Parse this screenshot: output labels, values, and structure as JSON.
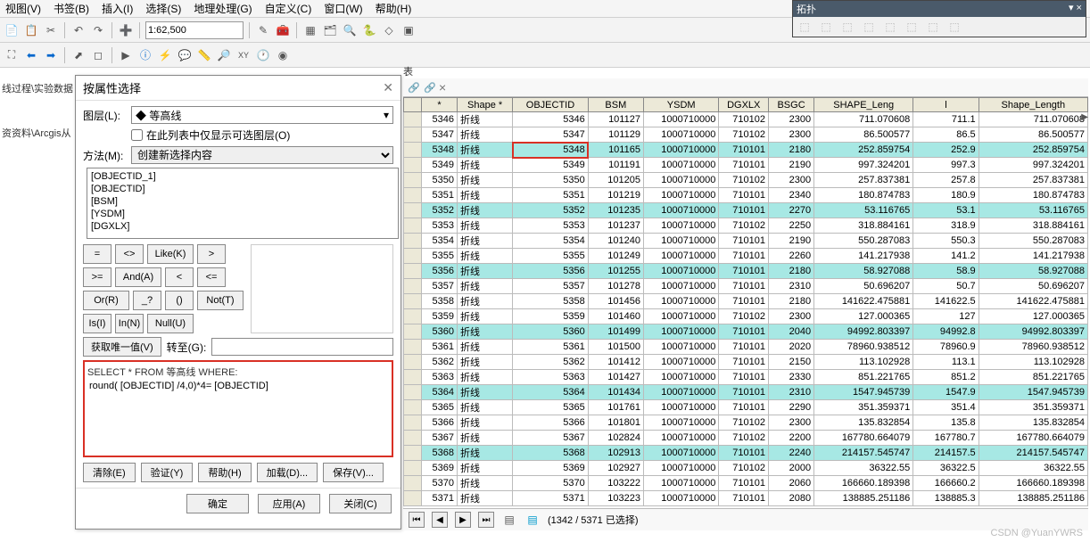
{
  "menu": [
    "视图(V)",
    "书签(B)",
    "插入(I)",
    "选择(S)",
    "地理处理(G)",
    "自定义(C)",
    "窗口(W)",
    "帮助(H)"
  ],
  "scale": "1:62,500",
  "topology": {
    "title": "拓扑",
    "close": "▾ ×"
  },
  "tree": {
    "l1": "线过程\\实验数据",
    "l2": "资资料\\Arcgis从"
  },
  "dialog": {
    "title": "按属性选择",
    "layer_label": "图层(L):",
    "layer_value": "◆ 等高线",
    "only_show": "在此列表中仅显示可选图层(O)",
    "method_label": "方法(M):",
    "method_value": "创建新选择内容",
    "fields": [
      "[OBJECTID_1]",
      "[OBJECTID]",
      "[BSM]",
      "[YSDM]",
      "[DGXLX]"
    ],
    "ops": {
      "eq": "=",
      "ne": "<>",
      "like": "Like(K)",
      "gt": ">",
      "ge": ">=",
      "and": "And(A)",
      "lt": "<",
      "le": "<=",
      "or": "Or(R)",
      "pct": "_?",
      "paren": "()",
      "not": "Not(T)",
      "is": "Is(I)",
      "in": "In(N)",
      "null": "Null(U)"
    },
    "uv": "获取唯一值(V)",
    "goto": "转至(G):",
    "sql_label": "SELECT * FROM 等高线 WHERE:",
    "sql_value": "round( [OBJECTID] /4,0)*4= [OBJECTID]",
    "btns": {
      "clear": "清除(E)",
      "verify": "验证(Y)",
      "help": "帮助(H)",
      "load": "加载(D)...",
      "save": "保存(V)..."
    },
    "footer": {
      "ok": "确定",
      "apply": "应用(A)",
      "close": "关闭(C)"
    }
  },
  "table": {
    "headers": [
      "*",
      "Shape *",
      "OBJECTID",
      "BSM",
      "YSDM",
      "DGXLX",
      "BSGC",
      "SHAPE_Leng",
      "l",
      "Shape_Length"
    ],
    "footer_text": "(1342 / 5371 已选择)",
    "shape_word": "折线",
    "rows": [
      {
        "fid": 5346,
        "oid": 5346,
        "bsm": 101127,
        "ysdm": "1000710000",
        "dgxlx": 710102,
        "bsgc": 2300,
        "len": "711.070608",
        "l": "711.1",
        "slen": "711.070608",
        "sel": false
      },
      {
        "fid": 5347,
        "oid": 5347,
        "bsm": 101129,
        "ysdm": "1000710000",
        "dgxlx": 710102,
        "bsgc": 2300,
        "len": "86.500577",
        "l": "86.5",
        "slen": "86.500577",
        "sel": false
      },
      {
        "fid": 5348,
        "oid": 5348,
        "bsm": 101165,
        "ysdm": "1000710000",
        "dgxlx": 710101,
        "bsgc": 2180,
        "len": "252.859754",
        "l": "252.9",
        "slen": "252.859754",
        "sel": true,
        "hl": true
      },
      {
        "fid": 5349,
        "oid": 5349,
        "bsm": 101191,
        "ysdm": "1000710000",
        "dgxlx": 710101,
        "bsgc": 2190,
        "len": "997.324201",
        "l": "997.3",
        "slen": "997.324201",
        "sel": false
      },
      {
        "fid": 5350,
        "oid": 5350,
        "bsm": 101205,
        "ysdm": "1000710000",
        "dgxlx": 710102,
        "bsgc": 2300,
        "len": "257.837381",
        "l": "257.8",
        "slen": "257.837381",
        "sel": false
      },
      {
        "fid": 5351,
        "oid": 5351,
        "bsm": 101219,
        "ysdm": "1000710000",
        "dgxlx": 710101,
        "bsgc": 2340,
        "len": "180.874783",
        "l": "180.9",
        "slen": "180.874783",
        "sel": false
      },
      {
        "fid": 5352,
        "oid": 5352,
        "bsm": 101235,
        "ysdm": "1000710000",
        "dgxlx": 710101,
        "bsgc": 2270,
        "len": "53.116765",
        "l": "53.1",
        "slen": "53.116765",
        "sel": true
      },
      {
        "fid": 5353,
        "oid": 5353,
        "bsm": 101237,
        "ysdm": "1000710000",
        "dgxlx": 710102,
        "bsgc": 2250,
        "len": "318.884161",
        "l": "318.9",
        "slen": "318.884161",
        "sel": false
      },
      {
        "fid": 5354,
        "oid": 5354,
        "bsm": 101240,
        "ysdm": "1000710000",
        "dgxlx": 710101,
        "bsgc": 2190,
        "len": "550.287083",
        "l": "550.3",
        "slen": "550.287083",
        "sel": false
      },
      {
        "fid": 5355,
        "oid": 5355,
        "bsm": 101249,
        "ysdm": "1000710000",
        "dgxlx": 710101,
        "bsgc": 2260,
        "len": "141.217938",
        "l": "141.2",
        "slen": "141.217938",
        "sel": false
      },
      {
        "fid": 5356,
        "oid": 5356,
        "bsm": 101255,
        "ysdm": "1000710000",
        "dgxlx": 710101,
        "bsgc": 2180,
        "len": "58.927088",
        "l": "58.9",
        "slen": "58.927088",
        "sel": true
      },
      {
        "fid": 5357,
        "oid": 5357,
        "bsm": 101278,
        "ysdm": "1000710000",
        "dgxlx": 710101,
        "bsgc": 2310,
        "len": "50.696207",
        "l": "50.7",
        "slen": "50.696207",
        "sel": false
      },
      {
        "fid": 5358,
        "oid": 5358,
        "bsm": 101456,
        "ysdm": "1000710000",
        "dgxlx": 710101,
        "bsgc": 2180,
        "len": "141622.475881",
        "l": "141622.5",
        "slen": "141622.475881",
        "sel": false
      },
      {
        "fid": 5359,
        "oid": 5359,
        "bsm": 101460,
        "ysdm": "1000710000",
        "dgxlx": 710102,
        "bsgc": 2300,
        "len": "127.000365",
        "l": "127",
        "slen": "127.000365",
        "sel": false
      },
      {
        "fid": 5360,
        "oid": 5360,
        "bsm": 101499,
        "ysdm": "1000710000",
        "dgxlx": 710101,
        "bsgc": 2040,
        "len": "94992.803397",
        "l": "94992.8",
        "slen": "94992.803397",
        "sel": true
      },
      {
        "fid": 5361,
        "oid": 5361,
        "bsm": 101500,
        "ysdm": "1000710000",
        "dgxlx": 710101,
        "bsgc": 2020,
        "len": "78960.938512",
        "l": "78960.9",
        "slen": "78960.938512",
        "sel": false
      },
      {
        "fid": 5362,
        "oid": 5362,
        "bsm": 101412,
        "ysdm": "1000710000",
        "dgxlx": 710101,
        "bsgc": 2150,
        "len": "113.102928",
        "l": "113.1",
        "slen": "113.102928",
        "sel": false
      },
      {
        "fid": 5363,
        "oid": 5363,
        "bsm": 101427,
        "ysdm": "1000710000",
        "dgxlx": 710101,
        "bsgc": 2330,
        "len": "851.221765",
        "l": "851.2",
        "slen": "851.221765",
        "sel": false
      },
      {
        "fid": 5364,
        "oid": 5364,
        "bsm": 101434,
        "ysdm": "1000710000",
        "dgxlx": 710101,
        "bsgc": 2310,
        "len": "1547.945739",
        "l": "1547.9",
        "slen": "1547.945739",
        "sel": true
      },
      {
        "fid": 5365,
        "oid": 5365,
        "bsm": 101761,
        "ysdm": "1000710000",
        "dgxlx": 710101,
        "bsgc": 2290,
        "len": "351.359371",
        "l": "351.4",
        "slen": "351.359371",
        "sel": false
      },
      {
        "fid": 5366,
        "oid": 5366,
        "bsm": 101801,
        "ysdm": "1000710000",
        "dgxlx": 710102,
        "bsgc": 2300,
        "len": "135.832854",
        "l": "135.8",
        "slen": "135.832854",
        "sel": false
      },
      {
        "fid": 5367,
        "oid": 5367,
        "bsm": 102824,
        "ysdm": "1000710000",
        "dgxlx": 710102,
        "bsgc": 2200,
        "len": "167780.664079",
        "l": "167780.7",
        "slen": "167780.664079",
        "sel": false
      },
      {
        "fid": 5368,
        "oid": 5368,
        "bsm": 102913,
        "ysdm": "1000710000",
        "dgxlx": 710101,
        "bsgc": 2240,
        "len": "214157.545747",
        "l": "214157.5",
        "slen": "214157.545747",
        "sel": true
      },
      {
        "fid": 5369,
        "oid": 5369,
        "bsm": 102927,
        "ysdm": "1000710000",
        "dgxlx": 710102,
        "bsgc": 2000,
        "len": "36322.55",
        "l": "36322.5",
        "slen": "36322.55",
        "sel": false
      },
      {
        "fid": 5370,
        "oid": 5370,
        "bsm": 103222,
        "ysdm": "1000710000",
        "dgxlx": 710101,
        "bsgc": 2060,
        "len": "166660.189398",
        "l": "166660.2",
        "slen": "166660.189398",
        "sel": false
      },
      {
        "fid": 5371,
        "oid": 5371,
        "bsm": 103223,
        "ysdm": "1000710000",
        "dgxlx": 710101,
        "bsgc": 2080,
        "len": "138885.251186",
        "l": "138885.3",
        "slen": "138885.251186",
        "sel": false
      }
    ]
  },
  "watermark": "CSDN @YuanYWRS",
  "tab_label": "表"
}
